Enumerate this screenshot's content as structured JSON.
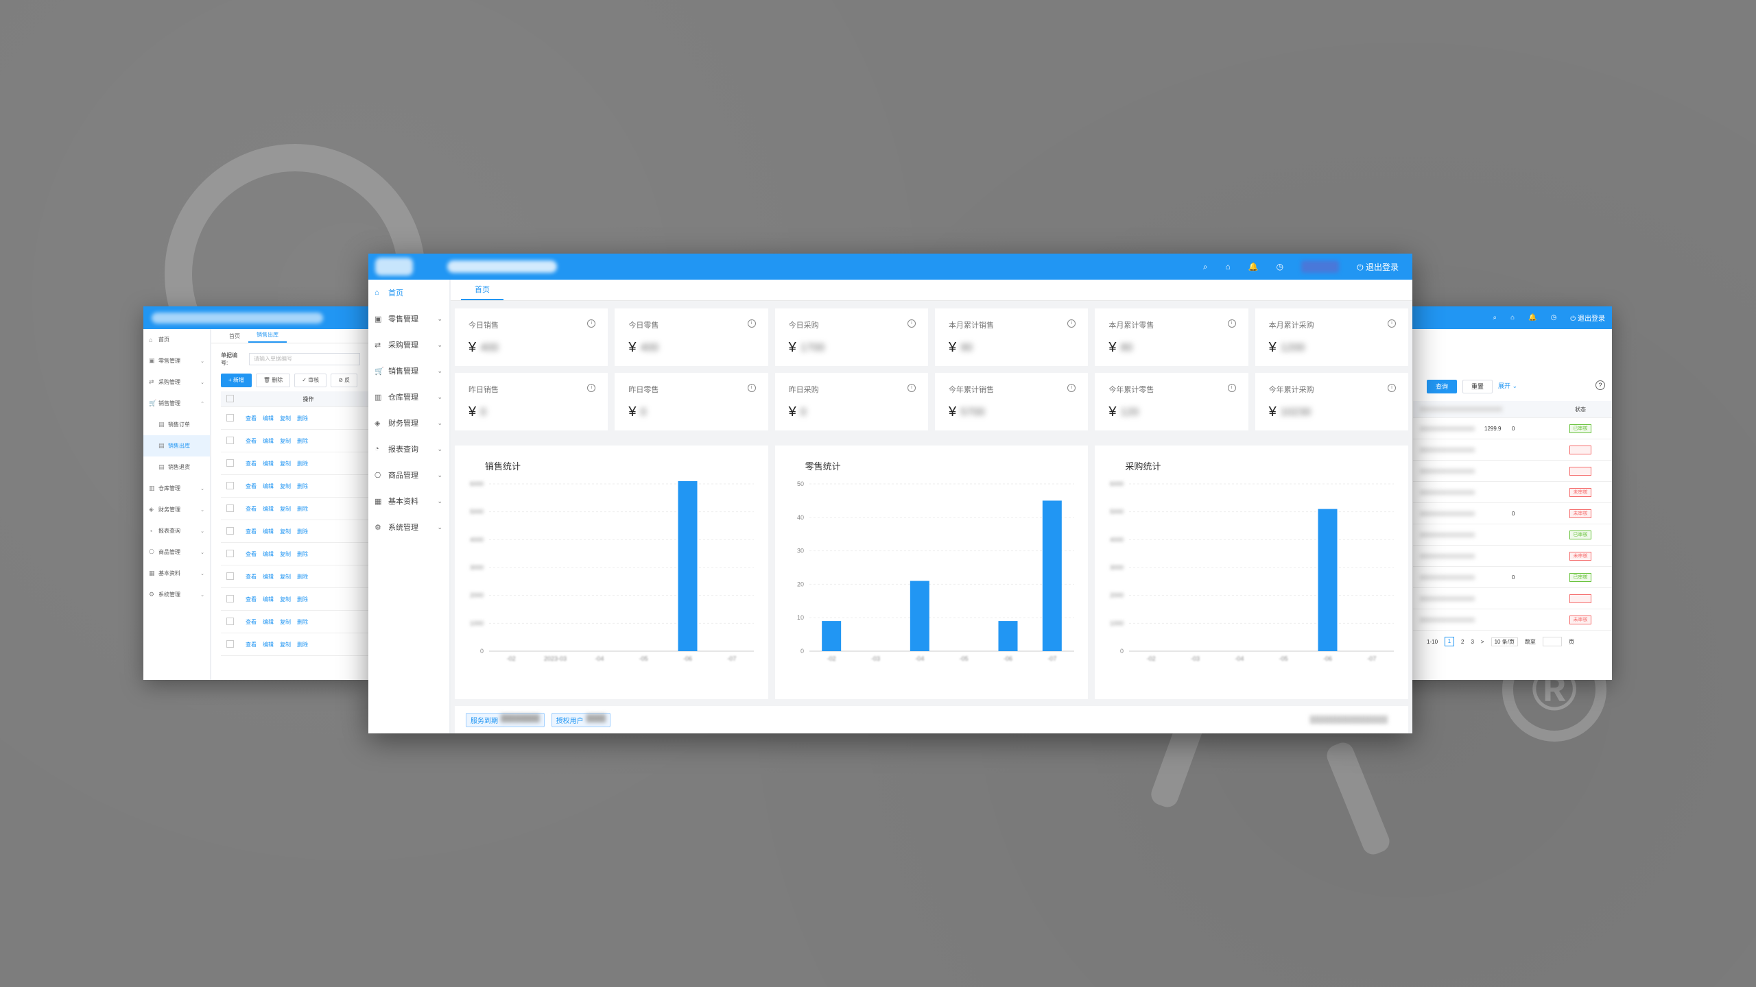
{
  "left_window": {
    "sidebar": [
      {
        "label": "首页",
        "icon": "home-icon",
        "chev": ""
      },
      {
        "label": "零售管理",
        "icon": "shop-icon",
        "chev": "⌄"
      },
      {
        "label": "采购管理",
        "icon": "swap-icon",
        "chev": "⌄"
      },
      {
        "label": "销售管理",
        "icon": "cart-icon",
        "chev": "⌃"
      },
      {
        "label": "销售订单",
        "icon": "doc-icon",
        "chev": "",
        "sub": true
      },
      {
        "label": "销售出库",
        "icon": "doc-icon",
        "chev": "",
        "sub": true,
        "active": true
      },
      {
        "label": "销售退货",
        "icon": "doc-icon",
        "chev": "",
        "sub": true
      },
      {
        "label": "仓库管理",
        "icon": "warehouse-icon",
        "chev": "⌄"
      },
      {
        "label": "财务管理",
        "icon": "money-icon",
        "chev": "⌄"
      },
      {
        "label": "报表查询",
        "icon": "chart-icon",
        "chev": "⌄"
      },
      {
        "label": "商品管理",
        "icon": "box-icon",
        "chev": "⌄"
      },
      {
        "label": "基本资料",
        "icon": "grid-icon",
        "chev": "⌄"
      },
      {
        "label": "系统管理",
        "icon": "gear-icon",
        "chev": "⌄"
      }
    ],
    "tabs": [
      "首页",
      "销售出库"
    ],
    "search_label": "单据编号:",
    "search_placeholder": "请输入单据编号",
    "buttons": {
      "add": "+ 新增",
      "delete": "删除",
      "audit": "审核",
      "report": "反"
    },
    "table_header": "操作",
    "row_ops": [
      "查看",
      "编辑",
      "复制",
      "删除"
    ],
    "row_count": 11
  },
  "right_window": {
    "buttons": {
      "query": "查询",
      "reset": "重置",
      "expand": "展开"
    },
    "status_header": "状态",
    "rows": [
      {
        "num": "1299.9",
        "qty": "0",
        "status": "已审核",
        "tone": "green"
      },
      {
        "num": "",
        "qty": "",
        "status": "",
        "tone": "red"
      },
      {
        "num": "",
        "qty": "",
        "status": "",
        "tone": "red"
      },
      {
        "num": "",
        "qty": "",
        "status": "未审核",
        "tone": "red"
      },
      {
        "num": "",
        "qty": "0",
        "status": "未审核",
        "tone": "red"
      },
      {
        "num": "",
        "qty": "",
        "status": "已审核",
        "tone": "green"
      },
      {
        "num": "",
        "qty": "",
        "status": "未审核",
        "tone": "red"
      },
      {
        "num": "",
        "qty": "0",
        "status": "已审核",
        "tone": "green"
      },
      {
        "num": "",
        "qty": "",
        "status": "",
        "tone": "red"
      },
      {
        "num": "",
        "qty": "",
        "status": "未审核",
        "tone": "red"
      }
    ],
    "pager": {
      "range": "1-10",
      "pages": [
        "1",
        "2",
        "3"
      ],
      "next": ">",
      "page_size": "10 条/页",
      "goto": "跳至",
      "unit": "页"
    }
  },
  "main_window": {
    "header": {
      "logout": "退出登录"
    },
    "sidebar": [
      {
        "label": "首页",
        "icon": "home-icon",
        "chev": "",
        "active": true
      },
      {
        "label": "零售管理",
        "icon": "shop-icon",
        "chev": "⌄"
      },
      {
        "label": "采购管理",
        "icon": "swap-icon",
        "chev": "⌄"
      },
      {
        "label": "销售管理",
        "icon": "cart-icon",
        "chev": "⌄"
      },
      {
        "label": "仓库管理",
        "icon": "warehouse-icon",
        "chev": "⌄"
      },
      {
        "label": "财务管理",
        "icon": "money-icon",
        "chev": "⌄"
      },
      {
        "label": "报表查询",
        "icon": "chart-icon",
        "chev": "⌄"
      },
      {
        "label": "商品管理",
        "icon": "box-icon",
        "chev": "⌄"
      },
      {
        "label": "基本资料",
        "icon": "grid-icon",
        "chev": "⌄"
      },
      {
        "label": "系统管理",
        "icon": "gear-icon",
        "chev": "⌄"
      }
    ],
    "tab": "首页",
    "cards": [
      {
        "label": "今日销售",
        "currency": "¥",
        "value": "400"
      },
      {
        "label": "今日零售",
        "currency": "¥",
        "value": "400"
      },
      {
        "label": "今日采购",
        "currency": "¥",
        "value": "1700"
      },
      {
        "label": "本月累计销售",
        "currency": "¥",
        "value": "90"
      },
      {
        "label": "本月累计零售",
        "currency": "¥",
        "value": "80"
      },
      {
        "label": "本月累计采购",
        "currency": "¥",
        "value": "1200"
      },
      {
        "label": "昨日销售",
        "currency": "¥",
        "value": "0"
      },
      {
        "label": "昨日零售",
        "currency": "¥",
        "value": "0"
      },
      {
        "label": "昨日采购",
        "currency": "¥",
        "value": "0"
      },
      {
        "label": "今年累计销售",
        "currency": "¥",
        "value": "5700"
      },
      {
        "label": "今年累计零售",
        "currency": "¥",
        "value": "120"
      },
      {
        "label": "今年累计采购",
        "currency": "¥",
        "value": "10230"
      }
    ],
    "footer": {
      "service_tag": "服务到期",
      "license_tag": "授权用户"
    }
  },
  "chart_data": [
    {
      "type": "bar",
      "title": "销售统计",
      "categories": [
        "-02",
        "2023-03",
        "-04",
        "-05",
        "-06",
        "-07"
      ],
      "values": [
        0,
        0,
        0,
        0,
        6100,
        0
      ],
      "ylim": [
        0,
        6000
      ],
      "yticks": [
        "0",
        "1000",
        "2000",
        "3000",
        "4000",
        "5000",
        "6000"
      ],
      "color": "#2196f3"
    },
    {
      "type": "bar",
      "title": "零售统计",
      "categories": [
        "-02",
        "-03",
        "-04",
        "-05",
        "-06",
        "-07"
      ],
      "values": [
        9,
        0,
        21,
        0,
        9,
        45
      ],
      "ylim": [
        0,
        50
      ],
      "yticks": [
        "0",
        "10",
        "20",
        "30",
        "40",
        "50"
      ],
      "color": "#2196f3"
    },
    {
      "type": "bar",
      "title": "采购统计",
      "categories": [
        "-02",
        "-03",
        "-04",
        "-05",
        "-06",
        "-07"
      ],
      "values": [
        0,
        0,
        0,
        0,
        5100,
        0
      ],
      "ylim": [
        0,
        6000
      ],
      "yticks": [
        "0",
        "1000",
        "2000",
        "3000",
        "4000",
        "5000",
        "6000"
      ],
      "color": "#2196f3"
    }
  ]
}
